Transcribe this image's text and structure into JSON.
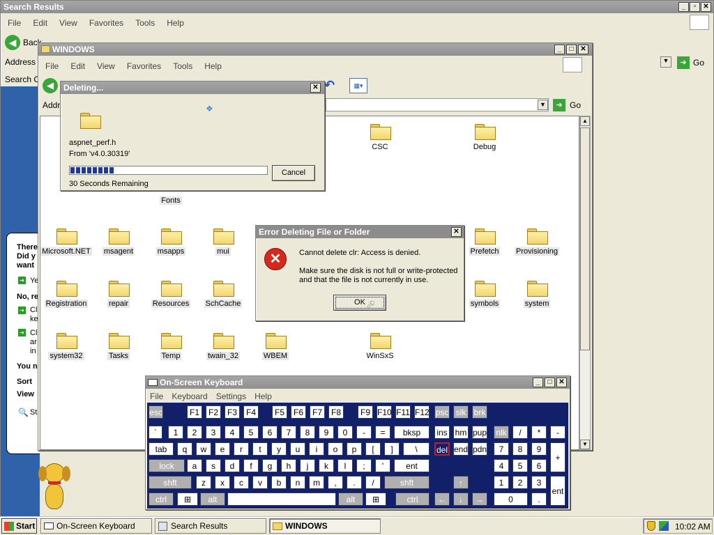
{
  "search_window": {
    "title": "Search Results",
    "menu": [
      "File",
      "Edit",
      "View",
      "Favorites",
      "Tools",
      "Help"
    ],
    "back_label": "Back",
    "address_label": "Address",
    "go_label": "Go",
    "search_pane_title": "Search C",
    "assistant_text": [
      "There",
      "Did y",
      "want",
      "Ye",
      "No, re",
      "Cl",
      "ke",
      "Cl",
      "ar",
      "in",
      "You n",
      "Sort",
      "View",
      "St"
    ]
  },
  "windows_window": {
    "title": "WINDOWS",
    "menu": [
      "File",
      "Edit",
      "View",
      "Favorites",
      "Tools",
      "Help"
    ],
    "address_label": "Addr",
    "go_label": "Go",
    "folders": [
      {
        "name": "CSC"
      },
      {
        "name": "Debug"
      },
      {
        "name": "Fonts"
      },
      {
        "name": "Microsoft.NET"
      },
      {
        "name": "msagent"
      },
      {
        "name": "msapps"
      },
      {
        "name": "mui"
      },
      {
        "name": "Prefetch"
      },
      {
        "name": "Provisioning"
      },
      {
        "name": "Registration"
      },
      {
        "name": "repair"
      },
      {
        "name": "Resources"
      },
      {
        "name": "SchCache"
      },
      {
        "name": "symbols"
      },
      {
        "name": "system"
      },
      {
        "name": "system32"
      },
      {
        "name": "Tasks"
      },
      {
        "name": "Temp"
      },
      {
        "name": "twain_32"
      },
      {
        "name": "WBEM"
      },
      {
        "name": "WinSxS"
      }
    ]
  },
  "deleting_dialog": {
    "title": "Deleting...",
    "file_name": "aspnet_perf.h",
    "from_text": "From 'v4.0.30319'",
    "remaining_text": "30 Seconds Remaining",
    "cancel_label": "Cancel",
    "progress": 0.22
  },
  "error_dialog": {
    "title": "Error Deleting File or Folder",
    "message": "Cannot delete clr: Access is denied.",
    "detail_line1": "Make sure the disk is not full or write-protected",
    "detail_line2": "and that the file is not currently in use.",
    "ok_label": "OK"
  },
  "osk": {
    "title": "On-Screen Keyboard",
    "menu": [
      "File",
      "Keyboard",
      "Settings",
      "Help"
    ],
    "row1": [
      "esc",
      "F1",
      "F2",
      "F3",
      "F4",
      "F5",
      "F6",
      "F7",
      "F8",
      "F9",
      "F10",
      "F11",
      "F12",
      "psc",
      "slk",
      "brk"
    ],
    "row2": [
      "`",
      "1",
      "2",
      "3",
      "4",
      "5",
      "6",
      "7",
      "8",
      "9",
      "0",
      "-",
      "=",
      "bksp",
      "ins",
      "hm",
      "pup",
      "nlk",
      "/",
      "*",
      "-"
    ],
    "row3": [
      "tab",
      "q",
      "w",
      "e",
      "r",
      "t",
      "y",
      "u",
      "i",
      "o",
      "p",
      "[",
      "]",
      "\\",
      "del",
      "end",
      "pdn",
      "7",
      "8",
      "9",
      "+"
    ],
    "row4": [
      "lock",
      "a",
      "s",
      "d",
      "f",
      "g",
      "h",
      "j",
      "k",
      "l",
      ";",
      "'",
      "ent",
      "4",
      "5",
      "6"
    ],
    "row5": [
      "shft",
      "z",
      "x",
      "c",
      "v",
      "b",
      "n",
      "m",
      ",",
      ".",
      "/",
      "shft",
      "1",
      "2",
      "3",
      "ent"
    ],
    "row6": [
      "ctrl",
      "alt",
      "alt",
      "ctrl",
      "0",
      "."
    ]
  },
  "taskbar": {
    "start_label": "Start",
    "items": [
      "On-Screen Keyboard",
      "Search Results",
      "WINDOWS"
    ],
    "clock": "10:02 AM"
  },
  "colors": {
    "osk_background": "#12206a",
    "error_icon": "#d42a1e",
    "progress_fill": "#1e3a9a"
  }
}
